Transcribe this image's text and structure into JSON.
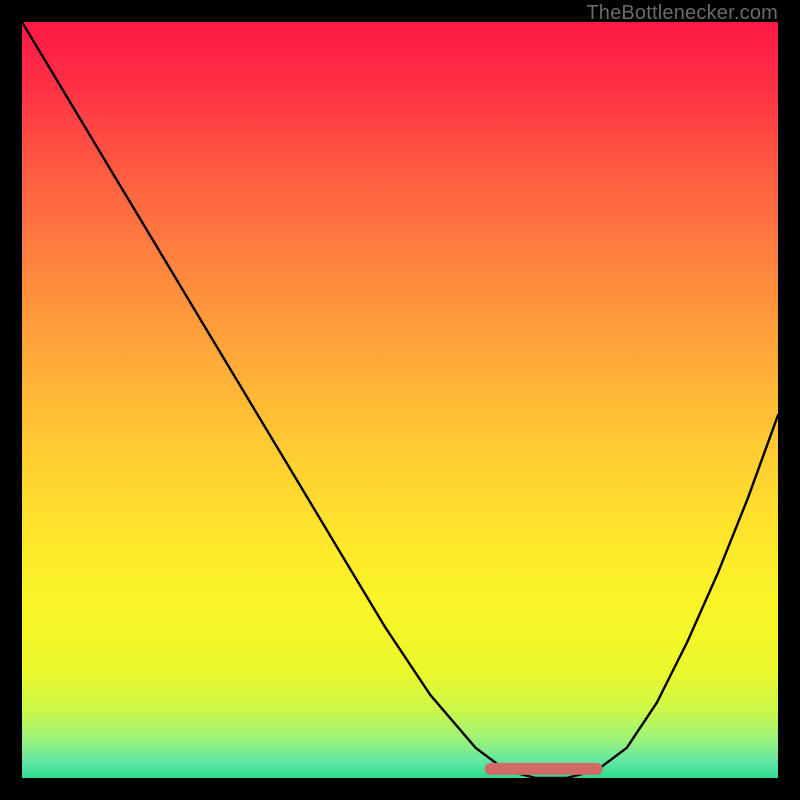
{
  "watermark": "TheBottlenecker.com",
  "chart_data": {
    "type": "line",
    "title": "",
    "xlabel": "",
    "ylabel": "",
    "xlim": [
      0,
      100
    ],
    "ylim": [
      0,
      100
    ],
    "series": [
      {
        "name": "bottleneck-curve",
        "x": [
          0,
          6,
          12,
          18,
          24,
          30,
          36,
          42,
          48,
          54,
          60,
          64,
          68,
          72,
          76,
          80,
          84,
          88,
          92,
          96,
          100
        ],
        "y": [
          100,
          90,
          80,
          70,
          60,
          50,
          40,
          30,
          20,
          11,
          4,
          1,
          0,
          0,
          1,
          4,
          10,
          18,
          27,
          37,
          48
        ]
      }
    ],
    "flat_segment": {
      "x_start": 62,
      "x_end": 76,
      "y": 1.2,
      "color": "#cf6a64"
    },
    "background_gradient_stops": [
      {
        "offset": 0.0,
        "color": "#ff1844"
      },
      {
        "offset": 0.08,
        "color": "#ff2f45"
      },
      {
        "offset": 0.18,
        "color": "#ff5542"
      },
      {
        "offset": 0.3,
        "color": "#ff7e3f"
      },
      {
        "offset": 0.42,
        "color": "#ffa23a"
      },
      {
        "offset": 0.55,
        "color": "#ffc833"
      },
      {
        "offset": 0.68,
        "color": "#ffe62b"
      },
      {
        "offset": 0.78,
        "color": "#f8f626"
      },
      {
        "offset": 0.86,
        "color": "#eaf82b"
      },
      {
        "offset": 0.91,
        "color": "#ccf84a"
      },
      {
        "offset": 0.95,
        "color": "#9af27a"
      },
      {
        "offset": 0.98,
        "color": "#5ee6a5"
      },
      {
        "offset": 1.0,
        "color": "#2ddc8f"
      }
    ]
  }
}
